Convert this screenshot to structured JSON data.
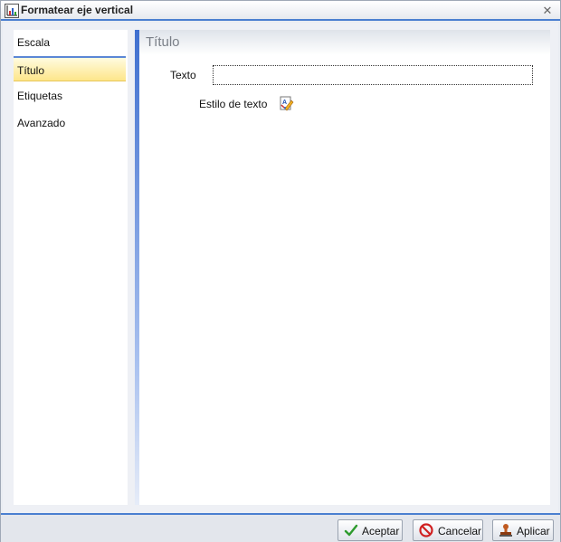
{
  "window": {
    "title": "Formatear eje vertical",
    "close_icon": "close-icon",
    "app_icon": "chart-axis-icon"
  },
  "sidebar": {
    "items": [
      {
        "label": "Escala",
        "selected": false
      },
      {
        "label": "Título",
        "selected": true
      },
      {
        "label": "Etiquetas",
        "selected": false
      },
      {
        "label": "Avanzado",
        "selected": false
      }
    ]
  },
  "content": {
    "title": "Título",
    "texto_label": "Texto",
    "texto_value": "",
    "estilo_label": "Estilo de texto",
    "estilo_icon": "text-style-icon"
  },
  "footer": {
    "accept_label": "Aceptar",
    "cancel_label": "Cancelar",
    "apply_label": "Aplicar"
  },
  "colors": {
    "accent": "#4a7fd0",
    "selected_item": "#fde68a",
    "accept_check": "#2e9b2e",
    "cancel_red": "#d02020"
  }
}
